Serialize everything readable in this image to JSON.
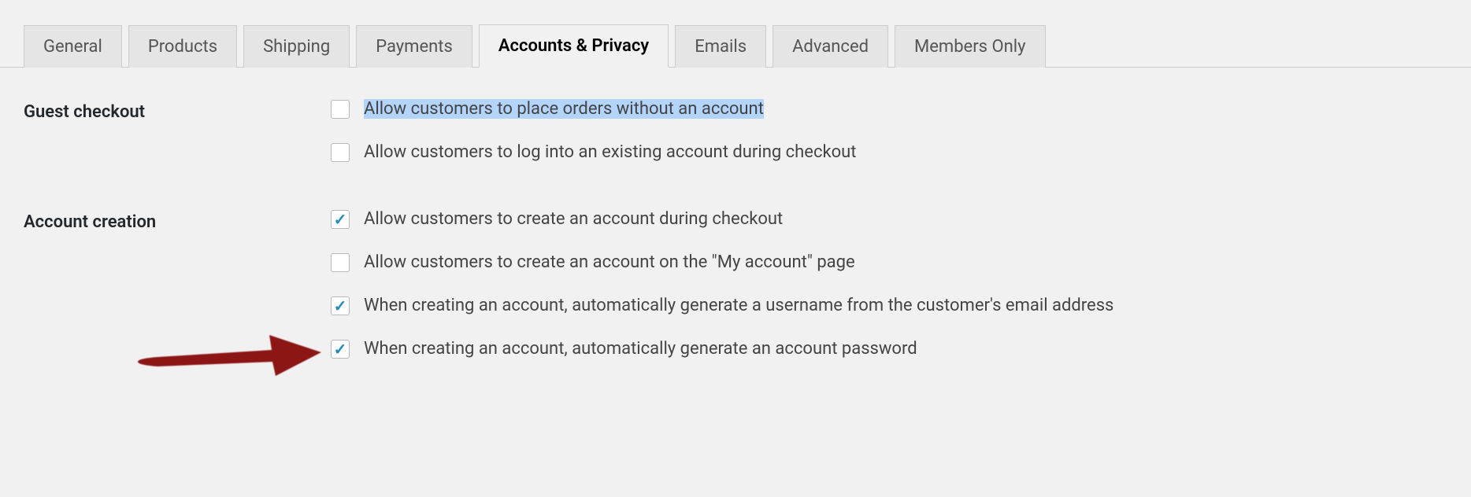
{
  "tabs": [
    {
      "label": "General",
      "active": false
    },
    {
      "label": "Products",
      "active": false
    },
    {
      "label": "Shipping",
      "active": false
    },
    {
      "label": "Payments",
      "active": false
    },
    {
      "label": "Accounts & Privacy",
      "active": true
    },
    {
      "label": "Emails",
      "active": false
    },
    {
      "label": "Advanced",
      "active": false
    },
    {
      "label": "Members Only",
      "active": false
    }
  ],
  "sections": {
    "guest_checkout": {
      "title": "Guest checkout",
      "options": [
        {
          "label": "Allow customers to place orders without an account",
          "checked": false,
          "highlighted": true
        },
        {
          "label": "Allow customers to log into an existing account during checkout",
          "checked": false,
          "highlighted": false
        }
      ]
    },
    "account_creation": {
      "title": "Account creation",
      "options": [
        {
          "label": "Allow customers to create an account during checkout",
          "checked": true,
          "highlighted": false
        },
        {
          "label": "Allow customers to create an account on the \"My account\" page",
          "checked": false,
          "highlighted": false
        },
        {
          "label": "When creating an account, automatically generate a username from the customer's email address",
          "checked": true,
          "highlighted": false
        },
        {
          "label": "When creating an account, automatically generate an account password",
          "checked": true,
          "highlighted": false
        }
      ]
    }
  }
}
